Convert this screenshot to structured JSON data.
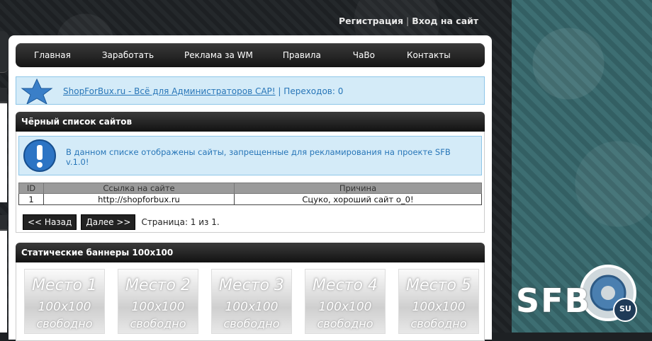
{
  "header": {
    "register_label": "Регистрация",
    "separator": "|",
    "login_label": "Вход на сайт"
  },
  "nav": {
    "items": [
      {
        "label": "Главная"
      },
      {
        "label": "Заработать"
      },
      {
        "label": "Реклама за WM"
      },
      {
        "label": "Правила"
      },
      {
        "label": "ЧаВо"
      },
      {
        "label": "Контакты"
      }
    ]
  },
  "promo": {
    "link_text": "ShopForBux.ru - Всё для Администраторов САР!",
    "separator": "|",
    "transitions": "Переходов: 0"
  },
  "blacklist": {
    "title": "Чёрный список сайтов",
    "notice": "В данном списке отображены сайты, запрещенные для рекламирования на проекте SFB v.1.0!",
    "columns": [
      "ID",
      "Ссылка на сайте",
      "Причина"
    ],
    "rows": [
      {
        "id": "1",
        "url": "http://shopforbux.ru",
        "reason": "Сцуко, хороший сайт о_0!"
      }
    ],
    "pager": {
      "prev_label": "<< Назад",
      "next_label": "Далее >>",
      "page_info": "Страница: 1 из 1."
    }
  },
  "banners": {
    "title": "Статические баннеры 100x100",
    "items": [
      {
        "place": "Место 1",
        "size": "100x100",
        "status": "свободно"
      },
      {
        "place": "Место 2",
        "size": "100x100",
        "status": "свободно"
      },
      {
        "place": "Место 3",
        "size": "100x100",
        "status": "свободно"
      },
      {
        "place": "Место 4",
        "size": "100x100",
        "status": "свободно"
      },
      {
        "place": "Место 5",
        "size": "100x100",
        "status": "свободно"
      }
    ]
  },
  "logo": {
    "text": "SFB",
    "badge": "SU"
  },
  "colors": {
    "link_blue": "#2876b8",
    "info_bg": "#d4ebf8",
    "teal_bg": "#3d6e72"
  }
}
